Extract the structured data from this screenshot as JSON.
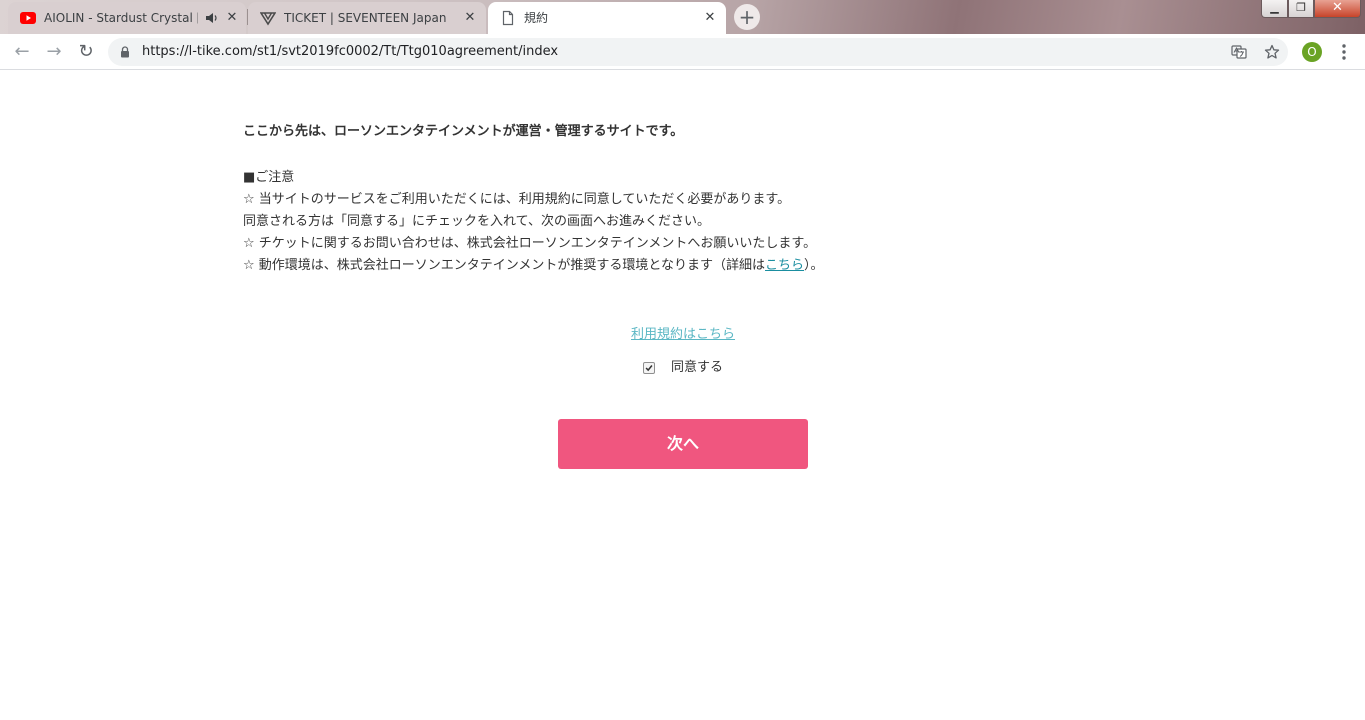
{
  "tabs": [
    {
      "title": "AIOLIN - Stardust Crystal [Of",
      "icon": "youtube-icon",
      "audio": true
    },
    {
      "title": "TICKET | SEVENTEEN Japan officia",
      "icon": "seventeen-logo-icon",
      "audio": false
    },
    {
      "title": "規約",
      "icon": "page-icon",
      "audio": false
    }
  ],
  "newtab_label": "+",
  "window": {
    "minimize": "▁",
    "maximize": "❐",
    "close": "✕"
  },
  "toolbar": {
    "back": "←",
    "forward": "→",
    "reload": "↻",
    "url": "https://l-tike.com/st1/svt2019fc0002/Tt/Ttg010agreement/index",
    "profile_initial": "O"
  },
  "page": {
    "intro": "ここから先は、ローソンエンタテインメントが運営・管理するサイトです。",
    "notice_heading": "■ご注意",
    "notice_lines": [
      "☆ 当サイトのサービスをご利用いただくには、利用規約に同意していただく必要があります。",
      "同意される方は「同意する」にチェックを入れて、次の画面へお進みください。",
      "☆ チケットに関するお問い合わせは、株式会社ローソンエンタテインメントへお願いいたします。"
    ],
    "env_line_prefix": "☆ 動作環境は、株式会社ローソンエンタテインメントが推奨する環境となります（詳細は",
    "env_line_link": "こちら",
    "env_line_suffix": "）。",
    "terms_link": "利用規約はこちら",
    "agree_label": "同意する",
    "agree_checked": true,
    "next_button": "次へ"
  },
  "colors": {
    "accent_button": "#f0567f",
    "link": "#1a8ea0",
    "terms_link": "#5bb7c4"
  }
}
